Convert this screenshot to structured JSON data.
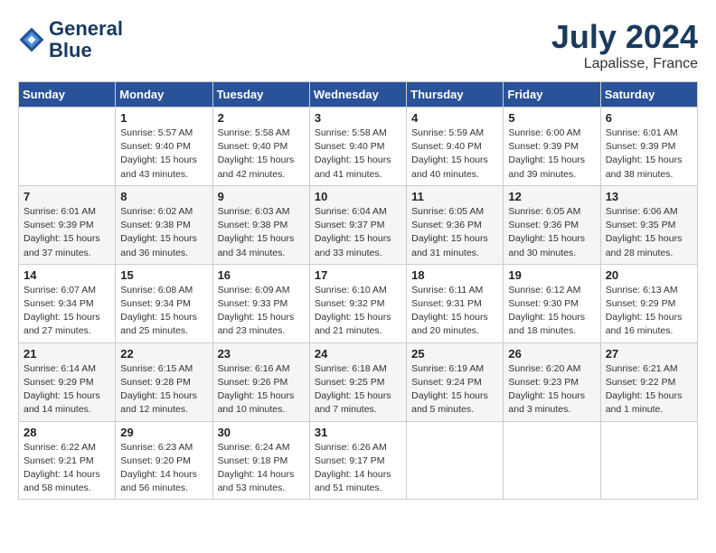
{
  "header": {
    "logo_line1": "General",
    "logo_line2": "Blue",
    "month": "July 2024",
    "location": "Lapalisse, France"
  },
  "weekdays": [
    "Sunday",
    "Monday",
    "Tuesday",
    "Wednesday",
    "Thursday",
    "Friday",
    "Saturday"
  ],
  "weeks": [
    [
      {
        "day": "",
        "info": ""
      },
      {
        "day": "1",
        "info": "Sunrise: 5:57 AM\nSunset: 9:40 PM\nDaylight: 15 hours\nand 43 minutes."
      },
      {
        "day": "2",
        "info": "Sunrise: 5:58 AM\nSunset: 9:40 PM\nDaylight: 15 hours\nand 42 minutes."
      },
      {
        "day": "3",
        "info": "Sunrise: 5:58 AM\nSunset: 9:40 PM\nDaylight: 15 hours\nand 41 minutes."
      },
      {
        "day": "4",
        "info": "Sunrise: 5:59 AM\nSunset: 9:40 PM\nDaylight: 15 hours\nand 40 minutes."
      },
      {
        "day": "5",
        "info": "Sunrise: 6:00 AM\nSunset: 9:39 PM\nDaylight: 15 hours\nand 39 minutes."
      },
      {
        "day": "6",
        "info": "Sunrise: 6:01 AM\nSunset: 9:39 PM\nDaylight: 15 hours\nand 38 minutes."
      }
    ],
    [
      {
        "day": "7",
        "info": "Sunrise: 6:01 AM\nSunset: 9:39 PM\nDaylight: 15 hours\nand 37 minutes."
      },
      {
        "day": "8",
        "info": "Sunrise: 6:02 AM\nSunset: 9:38 PM\nDaylight: 15 hours\nand 36 minutes."
      },
      {
        "day": "9",
        "info": "Sunrise: 6:03 AM\nSunset: 9:38 PM\nDaylight: 15 hours\nand 34 minutes."
      },
      {
        "day": "10",
        "info": "Sunrise: 6:04 AM\nSunset: 9:37 PM\nDaylight: 15 hours\nand 33 minutes."
      },
      {
        "day": "11",
        "info": "Sunrise: 6:05 AM\nSunset: 9:36 PM\nDaylight: 15 hours\nand 31 minutes."
      },
      {
        "day": "12",
        "info": "Sunrise: 6:05 AM\nSunset: 9:36 PM\nDaylight: 15 hours\nand 30 minutes."
      },
      {
        "day": "13",
        "info": "Sunrise: 6:06 AM\nSunset: 9:35 PM\nDaylight: 15 hours\nand 28 minutes."
      }
    ],
    [
      {
        "day": "14",
        "info": "Sunrise: 6:07 AM\nSunset: 9:34 PM\nDaylight: 15 hours\nand 27 minutes."
      },
      {
        "day": "15",
        "info": "Sunrise: 6:08 AM\nSunset: 9:34 PM\nDaylight: 15 hours\nand 25 minutes."
      },
      {
        "day": "16",
        "info": "Sunrise: 6:09 AM\nSunset: 9:33 PM\nDaylight: 15 hours\nand 23 minutes."
      },
      {
        "day": "17",
        "info": "Sunrise: 6:10 AM\nSunset: 9:32 PM\nDaylight: 15 hours\nand 21 minutes."
      },
      {
        "day": "18",
        "info": "Sunrise: 6:11 AM\nSunset: 9:31 PM\nDaylight: 15 hours\nand 20 minutes."
      },
      {
        "day": "19",
        "info": "Sunrise: 6:12 AM\nSunset: 9:30 PM\nDaylight: 15 hours\nand 18 minutes."
      },
      {
        "day": "20",
        "info": "Sunrise: 6:13 AM\nSunset: 9:29 PM\nDaylight: 15 hours\nand 16 minutes."
      }
    ],
    [
      {
        "day": "21",
        "info": "Sunrise: 6:14 AM\nSunset: 9:29 PM\nDaylight: 15 hours\nand 14 minutes."
      },
      {
        "day": "22",
        "info": "Sunrise: 6:15 AM\nSunset: 9:28 PM\nDaylight: 15 hours\nand 12 minutes."
      },
      {
        "day": "23",
        "info": "Sunrise: 6:16 AM\nSunset: 9:26 PM\nDaylight: 15 hours\nand 10 minutes."
      },
      {
        "day": "24",
        "info": "Sunrise: 6:18 AM\nSunset: 9:25 PM\nDaylight: 15 hours\nand 7 minutes."
      },
      {
        "day": "25",
        "info": "Sunrise: 6:19 AM\nSunset: 9:24 PM\nDaylight: 15 hours\nand 5 minutes."
      },
      {
        "day": "26",
        "info": "Sunrise: 6:20 AM\nSunset: 9:23 PM\nDaylight: 15 hours\nand 3 minutes."
      },
      {
        "day": "27",
        "info": "Sunrise: 6:21 AM\nSunset: 9:22 PM\nDaylight: 15 hours\nand 1 minute."
      }
    ],
    [
      {
        "day": "28",
        "info": "Sunrise: 6:22 AM\nSunset: 9:21 PM\nDaylight: 14 hours\nand 58 minutes."
      },
      {
        "day": "29",
        "info": "Sunrise: 6:23 AM\nSunset: 9:20 PM\nDaylight: 14 hours\nand 56 minutes."
      },
      {
        "day": "30",
        "info": "Sunrise: 6:24 AM\nSunset: 9:18 PM\nDaylight: 14 hours\nand 53 minutes."
      },
      {
        "day": "31",
        "info": "Sunrise: 6:26 AM\nSunset: 9:17 PM\nDaylight: 14 hours\nand 51 minutes."
      },
      {
        "day": "",
        "info": ""
      },
      {
        "day": "",
        "info": ""
      },
      {
        "day": "",
        "info": ""
      }
    ]
  ]
}
